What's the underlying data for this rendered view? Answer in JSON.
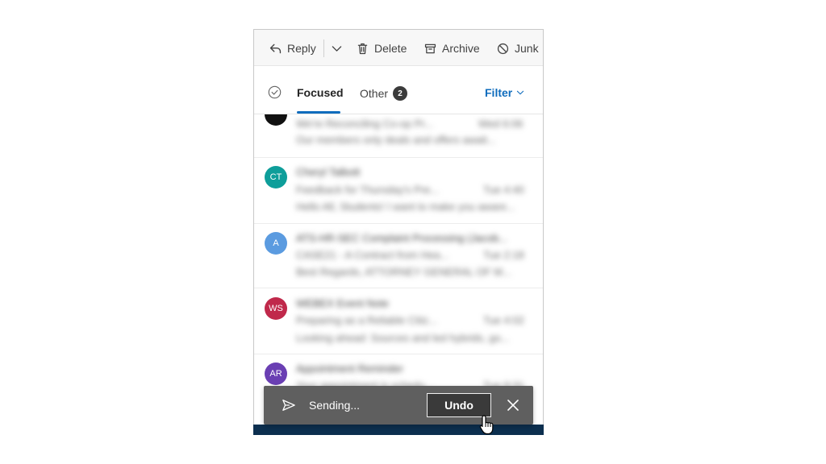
{
  "toolbar": {
    "reply_label": "Reply",
    "delete_label": "Delete",
    "archive_label": "Archive",
    "junk_label": "Junk"
  },
  "tabs": {
    "focused_label": "Focused",
    "other_label": "Other",
    "other_count": "2",
    "filter_label": "Filter"
  },
  "messages": [
    {
      "initials": "",
      "color": "#111111",
      "sender": "",
      "subject": "We're Reconciling Co-op Pr...",
      "time": "Wed 6:06",
      "preview": "Our members only deals and offers await..."
    },
    {
      "initials": "CT",
      "color": "#0e9e9a",
      "sender": "Cheryl Talbott",
      "subject": "Feedback for Thursday's Pre...",
      "time": "Tue 4:40",
      "preview": "Hello All, Students! I want to make you aware..."
    },
    {
      "initials": "A",
      "color": "#5b9be0",
      "sender": "ATS-HR-SEC Complaint Processing (Jacob...",
      "subject": "CASE21 - A Contract from Hea...",
      "time": "Tue 2:18",
      "preview": "Best Regards, ATTORNEY GENERAL OF M..."
    },
    {
      "initials": "WS",
      "color": "#c0294b",
      "sender": "WEBEX Event Note",
      "subject": "Preparing as a Reliable Citiz...",
      "time": "Tue 4:02",
      "preview": "Looking ahead: Sources and led hybrids, go..."
    },
    {
      "initials": "AR",
      "color": "#6a3fb3",
      "sender": "Appointment Reminder",
      "subject": "Your appointment is schedu...",
      "time": "Tue 9:31",
      "preview": ""
    }
  ],
  "toast": {
    "text": "Sending...",
    "undo_label": "Undo"
  }
}
